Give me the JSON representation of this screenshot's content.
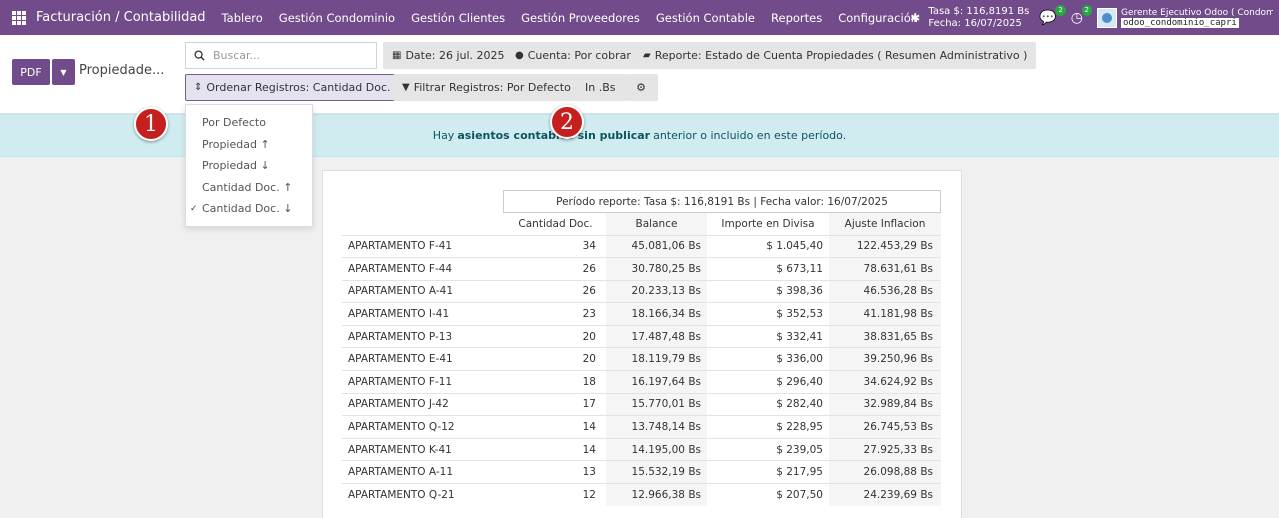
{
  "navbar": {
    "app_title": "Facturación / Contabilidad",
    "menu": [
      "Tablero",
      "Gestión Condominio",
      "Gestión Clientes",
      "Gestión Proveedores",
      "Gestión Contable",
      "Reportes",
      "Configuración"
    ],
    "tasa_line": "Tasa $: 116,8191 Bs",
    "fecha_line": "Fecha: 16/07/2025",
    "messages_badge": "2",
    "activities_badge": "2",
    "user_name": "Gerente Ejecutivo Odoo ( Condomi...",
    "database": "odoo_condominio_capri"
  },
  "control_panel": {
    "pdf_label": "PDF",
    "breadcrumb": "Propiedade...",
    "search_placeholder": "Buscar...",
    "filters": {
      "date": "Date: 26 jul. 2025",
      "account": "Cuenta: Por cobrar",
      "report": "Reporte: Estado de Cuenta Propiedades ( Resumen Administrativo )",
      "order": "Ordenar Registros: Cantidad Doc. ↓",
      "filter": "Filtrar Registros: Por Defecto",
      "currency": "In .Bs"
    }
  },
  "dropdown": {
    "items": [
      "Por Defecto",
      "Propiedad ↑",
      "Propiedad ↓",
      "Cantidad Doc. ↑",
      "Cantidad Doc. ↓"
    ],
    "checked_index": 4
  },
  "alert": {
    "prefix": "Hay",
    "bold": "asientos contables sin publicar",
    "suffix": "anterior o incluido en este período."
  },
  "markers": [
    "1",
    "2"
  ],
  "report": {
    "period": "Período reporte: Tasa $: 116,8191 Bs | Fecha valor: 16/07/2025",
    "headers": [
      "Cantidad Doc.",
      "Balance",
      "Importe en Divisa",
      "Ajuste Inflacion"
    ],
    "rows": [
      [
        "APARTAMENTO F-41",
        "34",
        "45.081,06 Bs",
        "$ 1.045,40",
        "122.453,29 Bs"
      ],
      [
        "APARTAMENTO F-44",
        "26",
        "30.780,25 Bs",
        "$ 673,11",
        "78.631,61 Bs"
      ],
      [
        "APARTAMENTO A-41",
        "26",
        "20.233,13 Bs",
        "$ 398,36",
        "46.536,28 Bs"
      ],
      [
        "APARTAMENTO I-41",
        "23",
        "18.166,34 Bs",
        "$ 352,53",
        "41.181,98 Bs"
      ],
      [
        "APARTAMENTO P-13",
        "20",
        "17.487,48 Bs",
        "$ 332,41",
        "38.831,65 Bs"
      ],
      [
        "APARTAMENTO E-41",
        "20",
        "18.119,79 Bs",
        "$ 336,00",
        "39.250,96 Bs"
      ],
      [
        "APARTAMENTO F-11",
        "18",
        "16.197,64 Bs",
        "$ 296,40",
        "34.624,92 Bs"
      ],
      [
        "APARTAMENTO J-42",
        "17",
        "15.770,01 Bs",
        "$ 282,40",
        "32.989,84 Bs"
      ],
      [
        "APARTAMENTO Q-12",
        "14",
        "13.748,14 Bs",
        "$ 228,95",
        "26.745,53 Bs"
      ],
      [
        "APARTAMENTO K-41",
        "14",
        "14.195,00 Bs",
        "$ 239,05",
        "27.925,33 Bs"
      ],
      [
        "APARTAMENTO A-11",
        "13",
        "15.532,19 Bs",
        "$ 217,95",
        "26.098,88 Bs"
      ],
      [
        "APARTAMENTO Q-21",
        "12",
        "12.966,38 Bs",
        "$ 207,50",
        "24.239,69 Bs"
      ]
    ]
  }
}
